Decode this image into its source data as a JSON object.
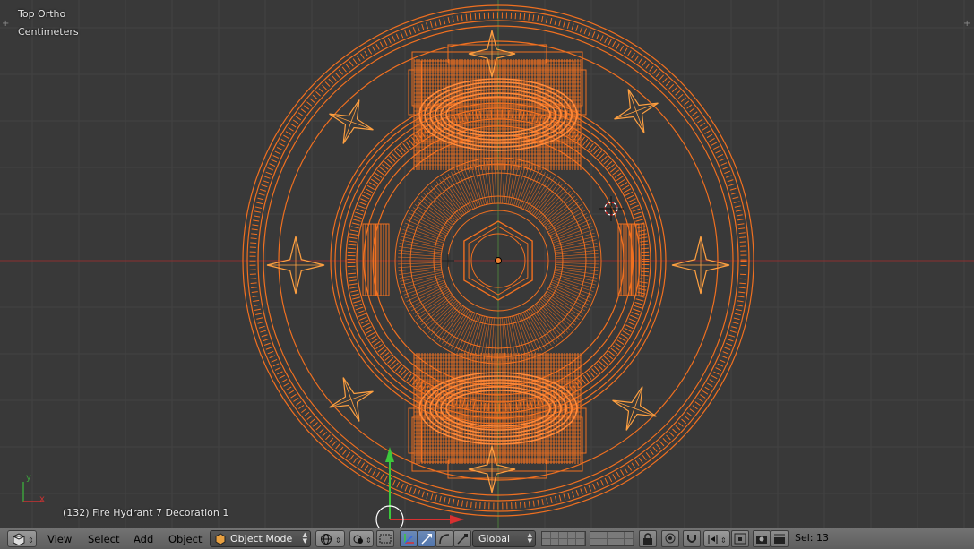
{
  "viewport": {
    "view_name": "Top Ortho",
    "units": "Centimeters",
    "object_info": "(132) Fire Hydrant 7 Decoration 1",
    "axis_x": "x",
    "axis_y": "y"
  },
  "header": {
    "menus": [
      "View",
      "Select",
      "Add",
      "Object"
    ],
    "mode": "Object Mode",
    "orientation": "Global",
    "selection": "Sel: 13"
  },
  "colors": {
    "viewport_bg": "#393939",
    "selected_wire": "#f07020",
    "active_wire": "#ffa040",
    "x_axis": "#c83232",
    "y_axis": "#3ca03c"
  },
  "icons": [
    "editor-type-icon",
    "viewport-shading-icon",
    "pivot-icon",
    "manipulator-icon",
    "translate-icon",
    "rotate-icon",
    "scale-icon",
    "lock-icon",
    "render-icon"
  ]
}
